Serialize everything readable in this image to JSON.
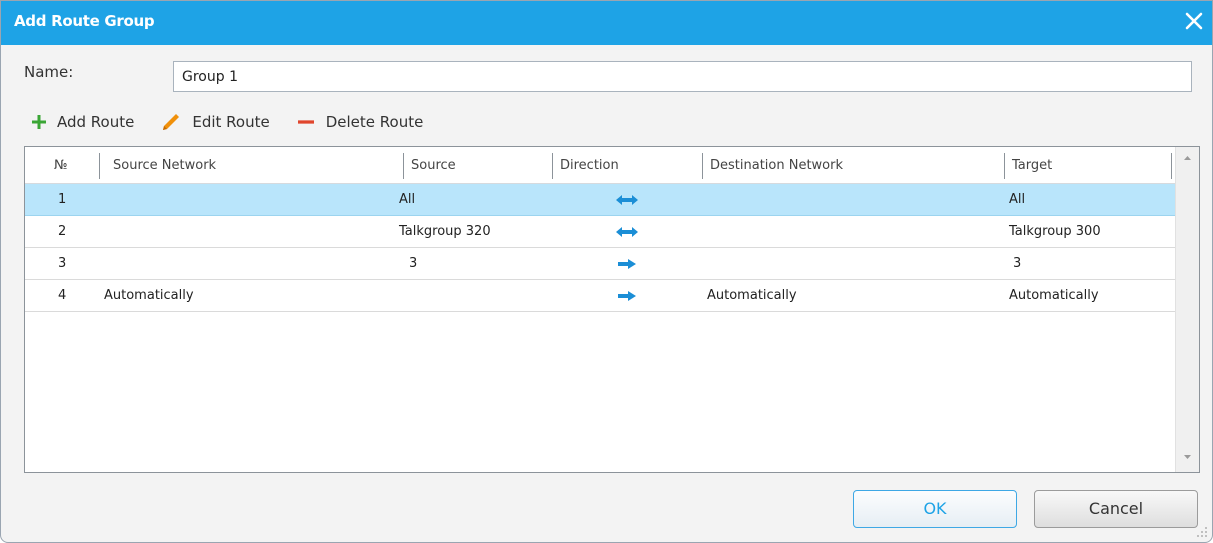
{
  "dialog": {
    "title": "Add Route Group",
    "name_label": "Name:",
    "name_value": "Group 1"
  },
  "toolbar": {
    "add_label": "Add Route",
    "edit_label": "Edit Route",
    "delete_label": "Delete Route"
  },
  "table": {
    "headers": {
      "num": "№",
      "source_network": "Source Network",
      "source": "Source",
      "direction": "Direction",
      "destination_network": "Destination Network",
      "target": "Target"
    },
    "rows": [
      {
        "num": "1",
        "source_network": "",
        "source": "All",
        "direction": "bidirectional",
        "destination_network": "",
        "target": "All",
        "selected": true
      },
      {
        "num": "2",
        "source_network": "",
        "source": "Talkgroup 320",
        "direction": "bidirectional",
        "destination_network": "",
        "target": "Talkgroup 300",
        "selected": false
      },
      {
        "num": "3",
        "source_network": "",
        "source": "3",
        "direction": "one-way",
        "destination_network": "",
        "target": "3",
        "selected": false
      },
      {
        "num": "4",
        "source_network": "Automatically",
        "source": "",
        "direction": "one-way",
        "destination_network": "Automatically",
        "target": "Automatically",
        "selected": false
      }
    ]
  },
  "buttons": {
    "ok": "OK",
    "cancel": "Cancel"
  },
  "colors": {
    "accent": "#1ea3e6",
    "selected_row": "#b9e5fb",
    "add_icon": "#3aa635",
    "edit_icon": "#f0900a",
    "delete_icon": "#e0452c"
  },
  "icons": {
    "close": "close-icon",
    "add": "plus-icon",
    "edit": "pencil-icon",
    "delete": "minus-icon",
    "bidirectional": "double-arrow-icon",
    "one_way": "right-arrow-icon"
  }
}
